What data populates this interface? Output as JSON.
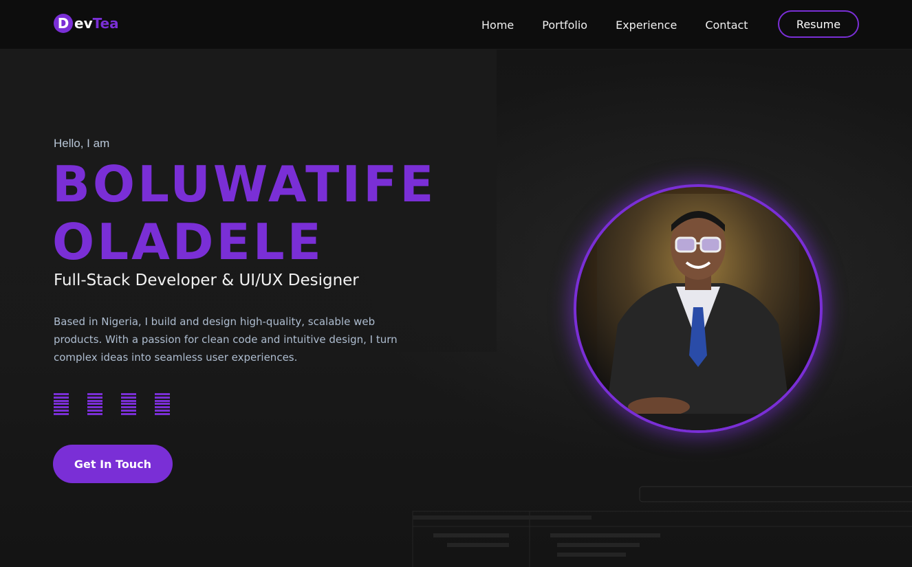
{
  "brand": {
    "badge_letter": "D",
    "text_ev": "ev",
    "text_tea": "Tea",
    "accent_color": "#7a2fd6"
  },
  "nav": {
    "items": [
      {
        "label": "Home"
      },
      {
        "label": "Portfolio"
      },
      {
        "label": "Experience"
      },
      {
        "label": "Contact"
      }
    ],
    "resume_label": "Resume"
  },
  "hero": {
    "greeting": "Hello, I am",
    "name_line1": "BOLUWATIFE",
    "name_line2": "OLADELE",
    "role": "Full-Stack Developer & UI/UX Designer",
    "bio": "Based in Nigeria, I build and design high-quality, scalable web products. With a passion for clean code and intuitive design, I turn complex ideas into seamless user experiences.",
    "cta_label": "Get In Touch",
    "social_icons": [
      "social-icon",
      "social-icon",
      "social-icon",
      "social-icon"
    ]
  },
  "avatar": {
    "description_icon": "profile-photo"
  }
}
